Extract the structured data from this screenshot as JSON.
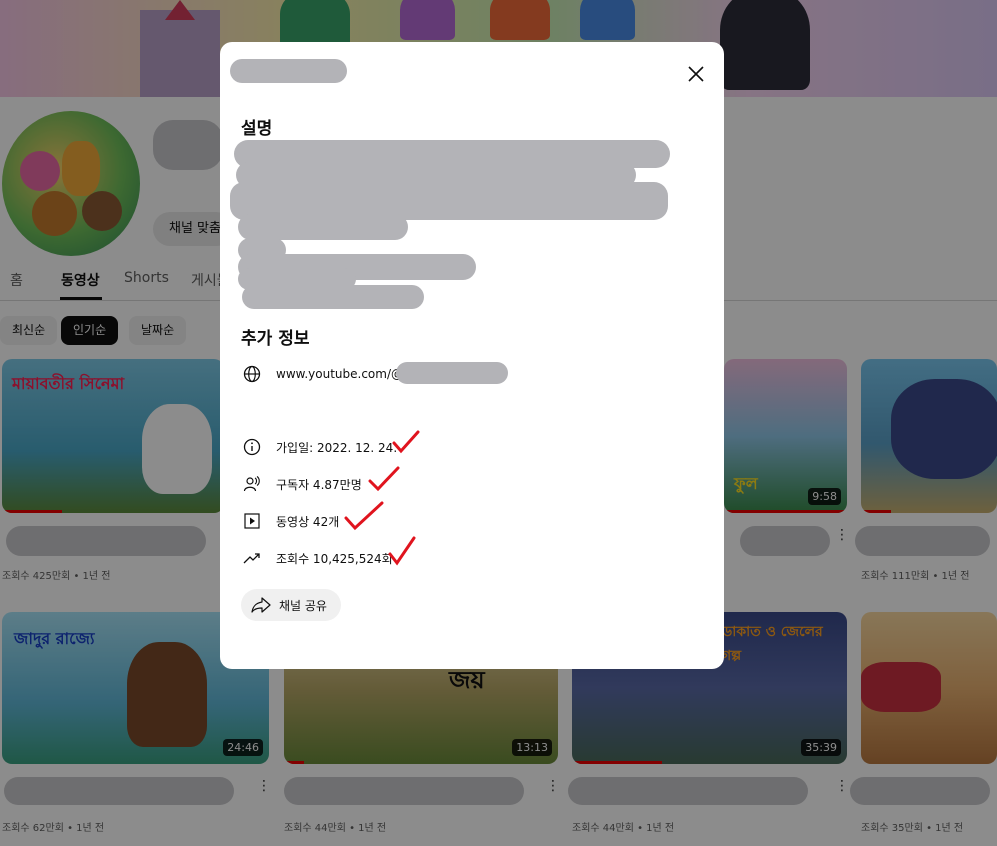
{
  "channel": {
    "customize_button": "채널 맞춤설정",
    "tabs": [
      {
        "label": "홈"
      },
      {
        "label": "동영상"
      },
      {
        "label": "Shorts"
      },
      {
        "label": "게시물"
      }
    ],
    "chips": [
      {
        "label": "최신순"
      },
      {
        "label": "인기순"
      },
      {
        "label": "날짜순"
      }
    ]
  },
  "videos": [
    {
      "thumb_text": "মায়াবতীর সিনেমা",
      "meta": "조회수 425만회 • 1년 전",
      "duration": ""
    },
    {
      "thumb_text": "",
      "meta": "",
      "duration": ""
    },
    {
      "thumb_text": "",
      "meta": "",
      "duration": ""
    },
    {
      "thumb_text": "ফুল",
      "meta": "",
      "duration": "9:58"
    },
    {
      "thumb_text": "",
      "meta": "조회수 111만회 • 1년 전",
      "duration": ""
    },
    {
      "thumb_text": "জাদুর রাজ্যে",
      "meta": "조회수 62만회 • 1년 전",
      "duration": "24:46"
    },
    {
      "thumb_text": "জয়",
      "meta": "조회수 44만회 • 1년 전",
      "duration": "13:13"
    },
    {
      "thumb_text": "ডাকাত ও জেলের গল্প",
      "meta": "조회수 44만회 • 1년 전",
      "duration": "35:39"
    },
    {
      "thumb_text": "",
      "meta": "조회수 35만회 • 1년 전",
      "duration": ""
    }
  ],
  "dialog": {
    "description_heading": "설명",
    "more_info_heading": "추가 정보",
    "url": "www.youtube.com/@",
    "joined": "가입일: 2022. 12. 24.",
    "subscribers": "구독자 4.87만명",
    "videos": "동영상 42개",
    "views": "조회수 10,425,524회",
    "share_button": "채널 공유"
  },
  "colors": {
    "overlay": "rgba(0,0,0,0.45)",
    "check_mark": "#e0141e",
    "progress": "#e00000"
  }
}
